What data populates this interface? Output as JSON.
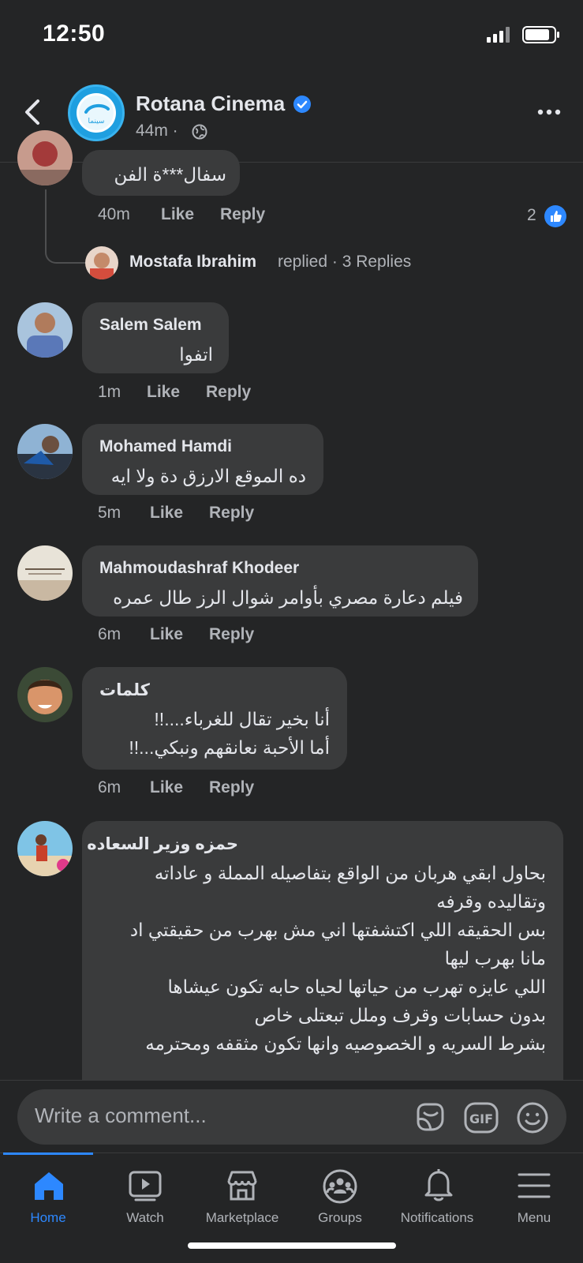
{
  "status_bar": {
    "time": "12:50"
  },
  "header": {
    "page_name": "Rotana Cinema",
    "time_ago": "44m ·",
    "avatar_text": "سينما"
  },
  "thread": {
    "partial_comment": {
      "text": "سفال***ة  الفن",
      "time": "40m",
      "like": "Like",
      "reply": "Reply",
      "reaction_count": "2"
    },
    "replied_by": {
      "name": "Mostafa Ibrahim",
      "suffix": "replied · 3 Replies"
    }
  },
  "comments": [
    {
      "name": "Salem Salem",
      "lines": [
        "اتفوا"
      ],
      "time": "1m",
      "like": "Like",
      "reply": "Reply"
    },
    {
      "name": "Mohamed Hamdi",
      "lines": [
        "ده الموقع الارزق دة ولا ايه"
      ],
      "time": "5m",
      "like": "Like",
      "reply": "Reply"
    },
    {
      "name": "Mahmoudashraf Khodeer",
      "lines": [
        "فيلم دعارة مصري بأوامر شوال الرز طال عمره"
      ],
      "time": "6m",
      "like": "Like",
      "reply": "Reply"
    },
    {
      "name": "كلمات",
      "lines": [
        "أنا بخير تقال للغرباء....!!",
        "أما الأحبة نعانقهم ونبكي...!!"
      ],
      "time": "6m",
      "like": "Like",
      "reply": "Reply"
    },
    {
      "name": "حمزه وزير السعاده",
      "lines": [
        "بحاول ابقي هربان من الواقع بتفاصيله المملة و عاداته",
        "وتقاليده وقرفه",
        "بس الحقيقه اللي اكتشفتها اني مش بهرب من حقيقتي اد",
        "مانا بهرب ليها",
        "اللي عايزه تهرب من حياتها لحياه حابه تكون عيشاها",
        "بدون حسابات وقرف وملل تبعتلى خاص",
        "بشرط السريه و الخصوصيه وانها تكون مثقفه ومحترمه"
      ]
    }
  ],
  "composer": {
    "placeholder": "Write a comment..."
  },
  "nav": [
    {
      "label": "Home",
      "icon": "home-icon",
      "active": true
    },
    {
      "label": "Watch",
      "icon": "watch-icon"
    },
    {
      "label": "Marketplace",
      "icon": "marketplace-icon"
    },
    {
      "label": "Groups",
      "icon": "groups-icon"
    },
    {
      "label": "Notifications",
      "icon": "bell-icon"
    },
    {
      "label": "Menu",
      "icon": "menu-icon"
    }
  ],
  "colors": {
    "background": "#242526",
    "bubble": "#3a3b3c",
    "accent": "#2d88ff",
    "text": "#e4e6eb",
    "muted": "#b0b3b8"
  }
}
